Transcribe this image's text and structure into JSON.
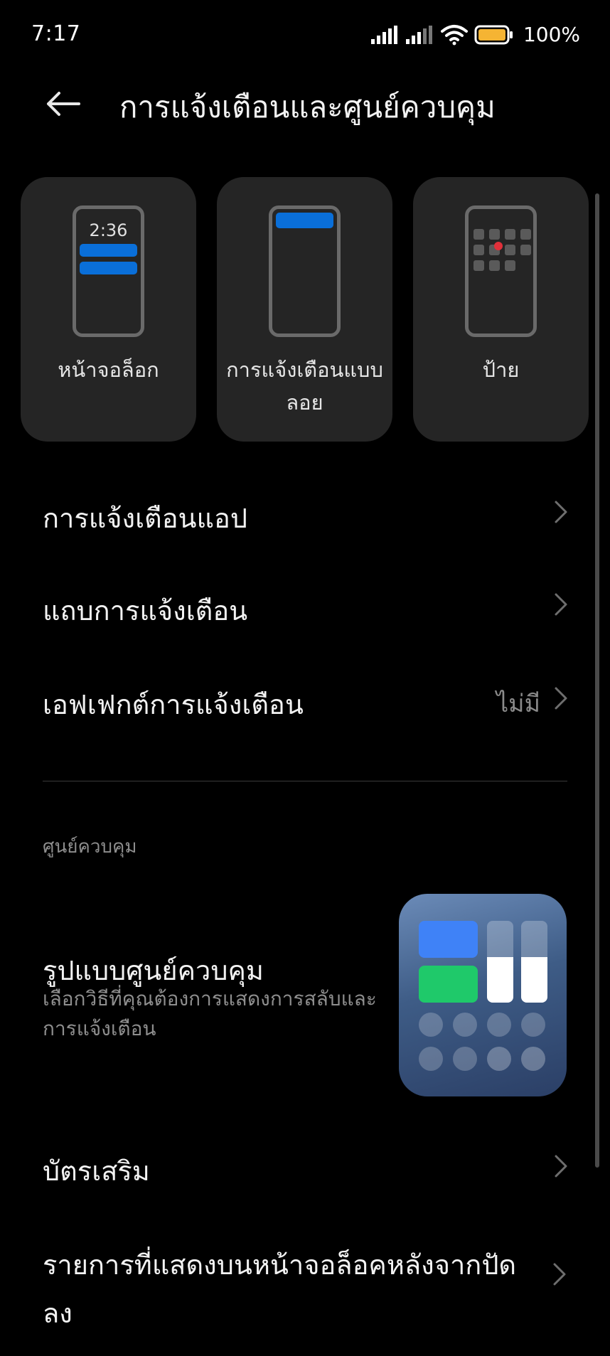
{
  "status_bar": {
    "time": "7:17",
    "battery_text": "100%",
    "battery_color": "#f5b433"
  },
  "header": {
    "title": "การแจ้งเตือนและศูนย์ควบคุม"
  },
  "style_cards": [
    {
      "label": "หน้าจอล็อก",
      "preview_time": "2:36"
    },
    {
      "label": "การแจ้งเตือนแบบลอย"
    },
    {
      "label": "ป้าย"
    }
  ],
  "notification_rows": {
    "app_notifications": "การแจ้งเตือนแอป",
    "notification_shade": "แถบการแจ้งเตือน",
    "notification_effects": "เอฟเฟกต์การแจ้งเตือน",
    "notification_effects_value": "ไม่มี"
  },
  "control_center": {
    "section_header": "ศูนย์ควบคุม",
    "style_title": "รูปแบบศูนย์ควบคุม",
    "style_desc": "เลือกวิธีที่คุณต้องการแสดงการสลับและการแจ้งเตือน",
    "accessories": "บัตรเสริม",
    "lockscreen_items": "รายการที่แสดงบนหน้าจอล็อคหลังจากปัดลง"
  },
  "colors": {
    "accent_blue": "#0a6fd9",
    "badge_red": "#e0303a",
    "tile_blue": "#3f82f7",
    "tile_green": "#1fc96a"
  }
}
